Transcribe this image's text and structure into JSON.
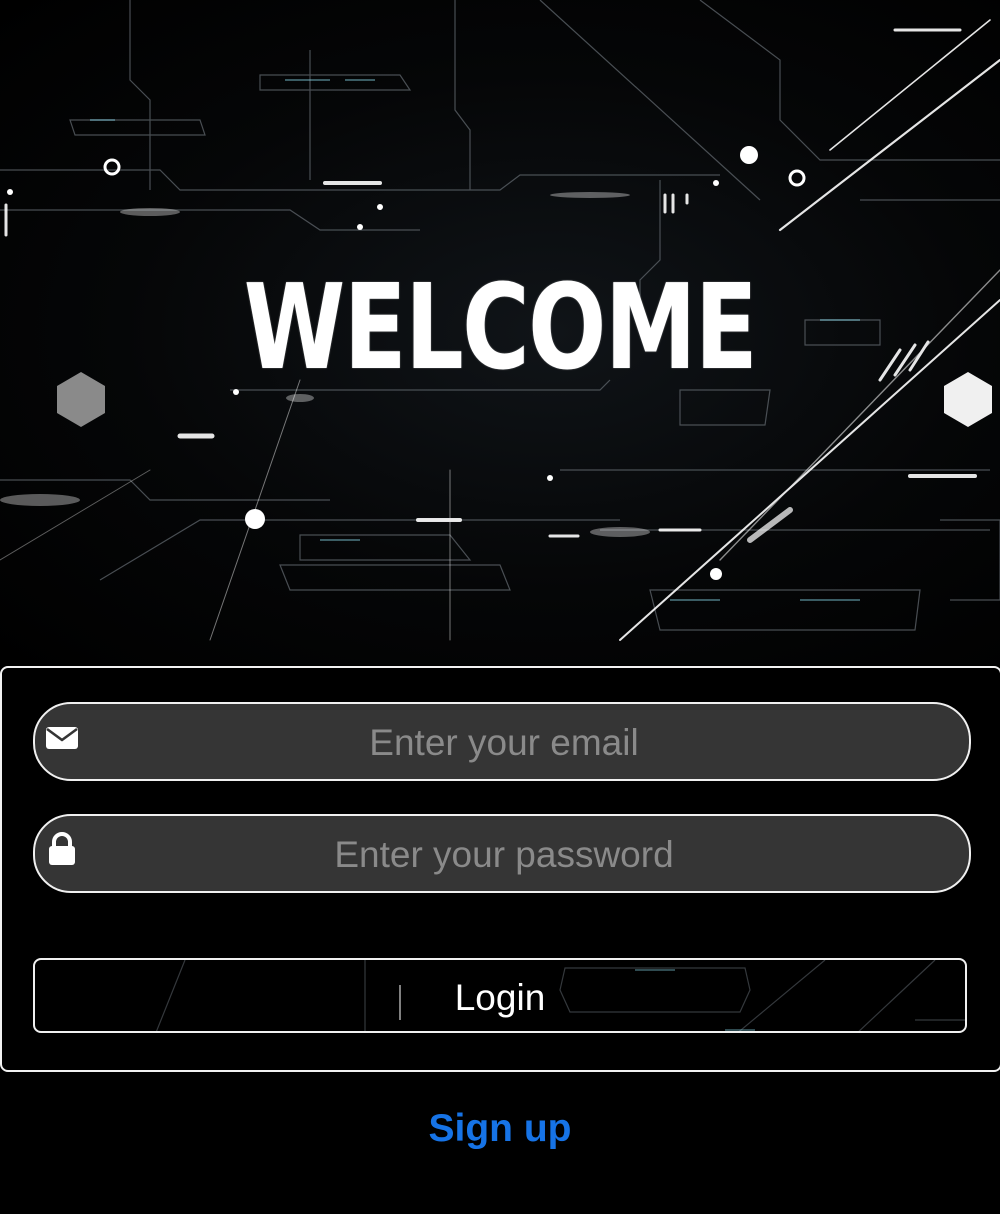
{
  "hero": {
    "title": "WELCOME"
  },
  "form": {
    "email_placeholder": "Enter your email",
    "password_placeholder": "Enter your password",
    "login_label": "Login",
    "email_icon": "envelope-icon",
    "password_icon": "lock-icon"
  },
  "signup": {
    "label": "Sign up"
  },
  "colors": {
    "background": "#000000",
    "field_fill": "#353535",
    "border": "#f0f0f0",
    "link": "#1673e6"
  }
}
